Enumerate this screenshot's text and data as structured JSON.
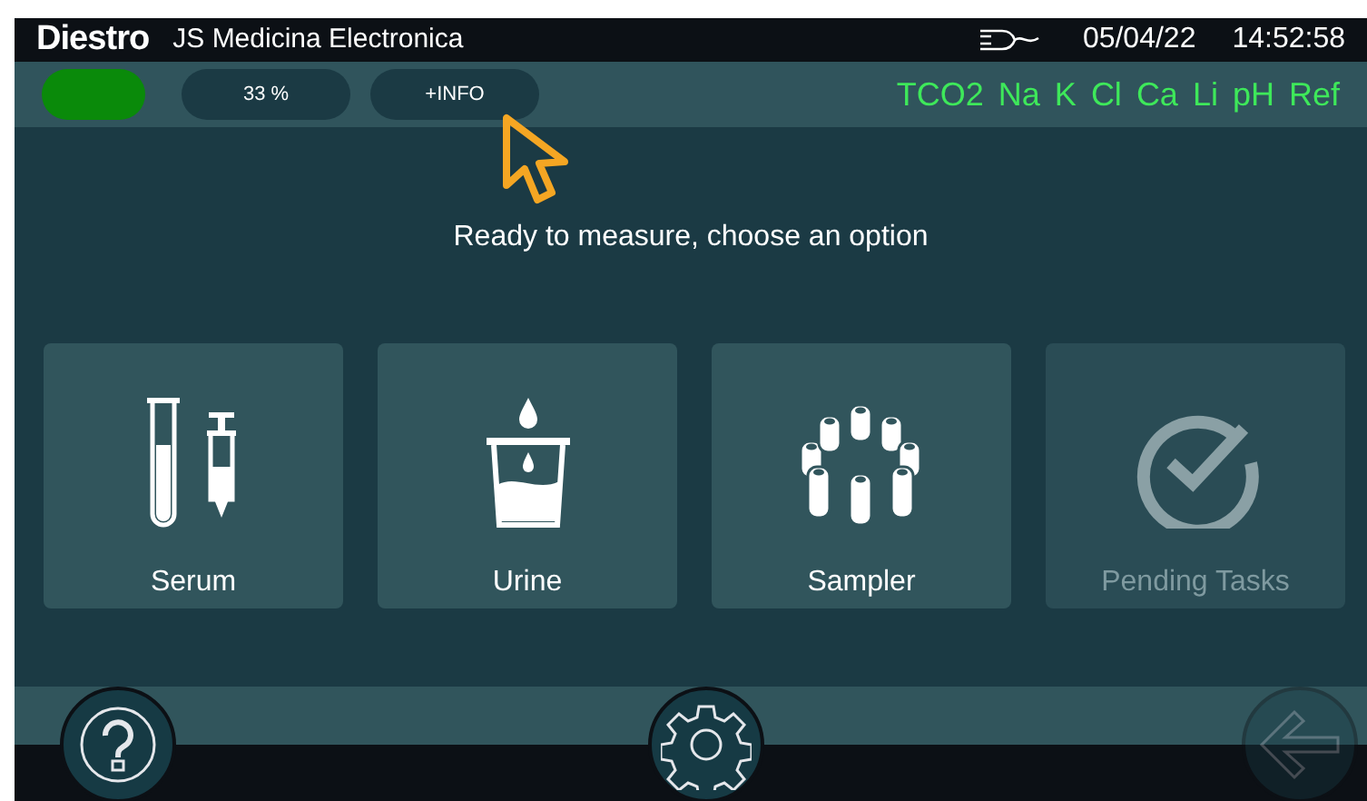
{
  "header": {
    "brand": "Diestro",
    "title": "JS Medicina Electronica",
    "date": "05/04/22",
    "time": "14:52:58"
  },
  "toolbar": {
    "status": {
      "color": "#0a8a0a"
    },
    "battery": "33 %",
    "info_button": "+INFO",
    "parameters": [
      "TCO2",
      "Na",
      "K",
      "Cl",
      "Ca",
      "Li",
      "pH",
      "Ref"
    ]
  },
  "message": "Ready to measure, choose an option",
  "options": [
    {
      "kind": "serum",
      "label": "Serum",
      "disabled": false
    },
    {
      "kind": "urine",
      "label": "Urine",
      "disabled": false
    },
    {
      "kind": "sampler",
      "label": "Sampler",
      "disabled": false
    },
    {
      "kind": "pending",
      "label": "Pending Tasks",
      "disabled": true
    }
  ],
  "bottom_buttons": [
    {
      "kind": "help",
      "disabled": false
    },
    {
      "kind": "settings",
      "disabled": false
    },
    {
      "kind": "back",
      "disabled": true
    }
  ]
}
